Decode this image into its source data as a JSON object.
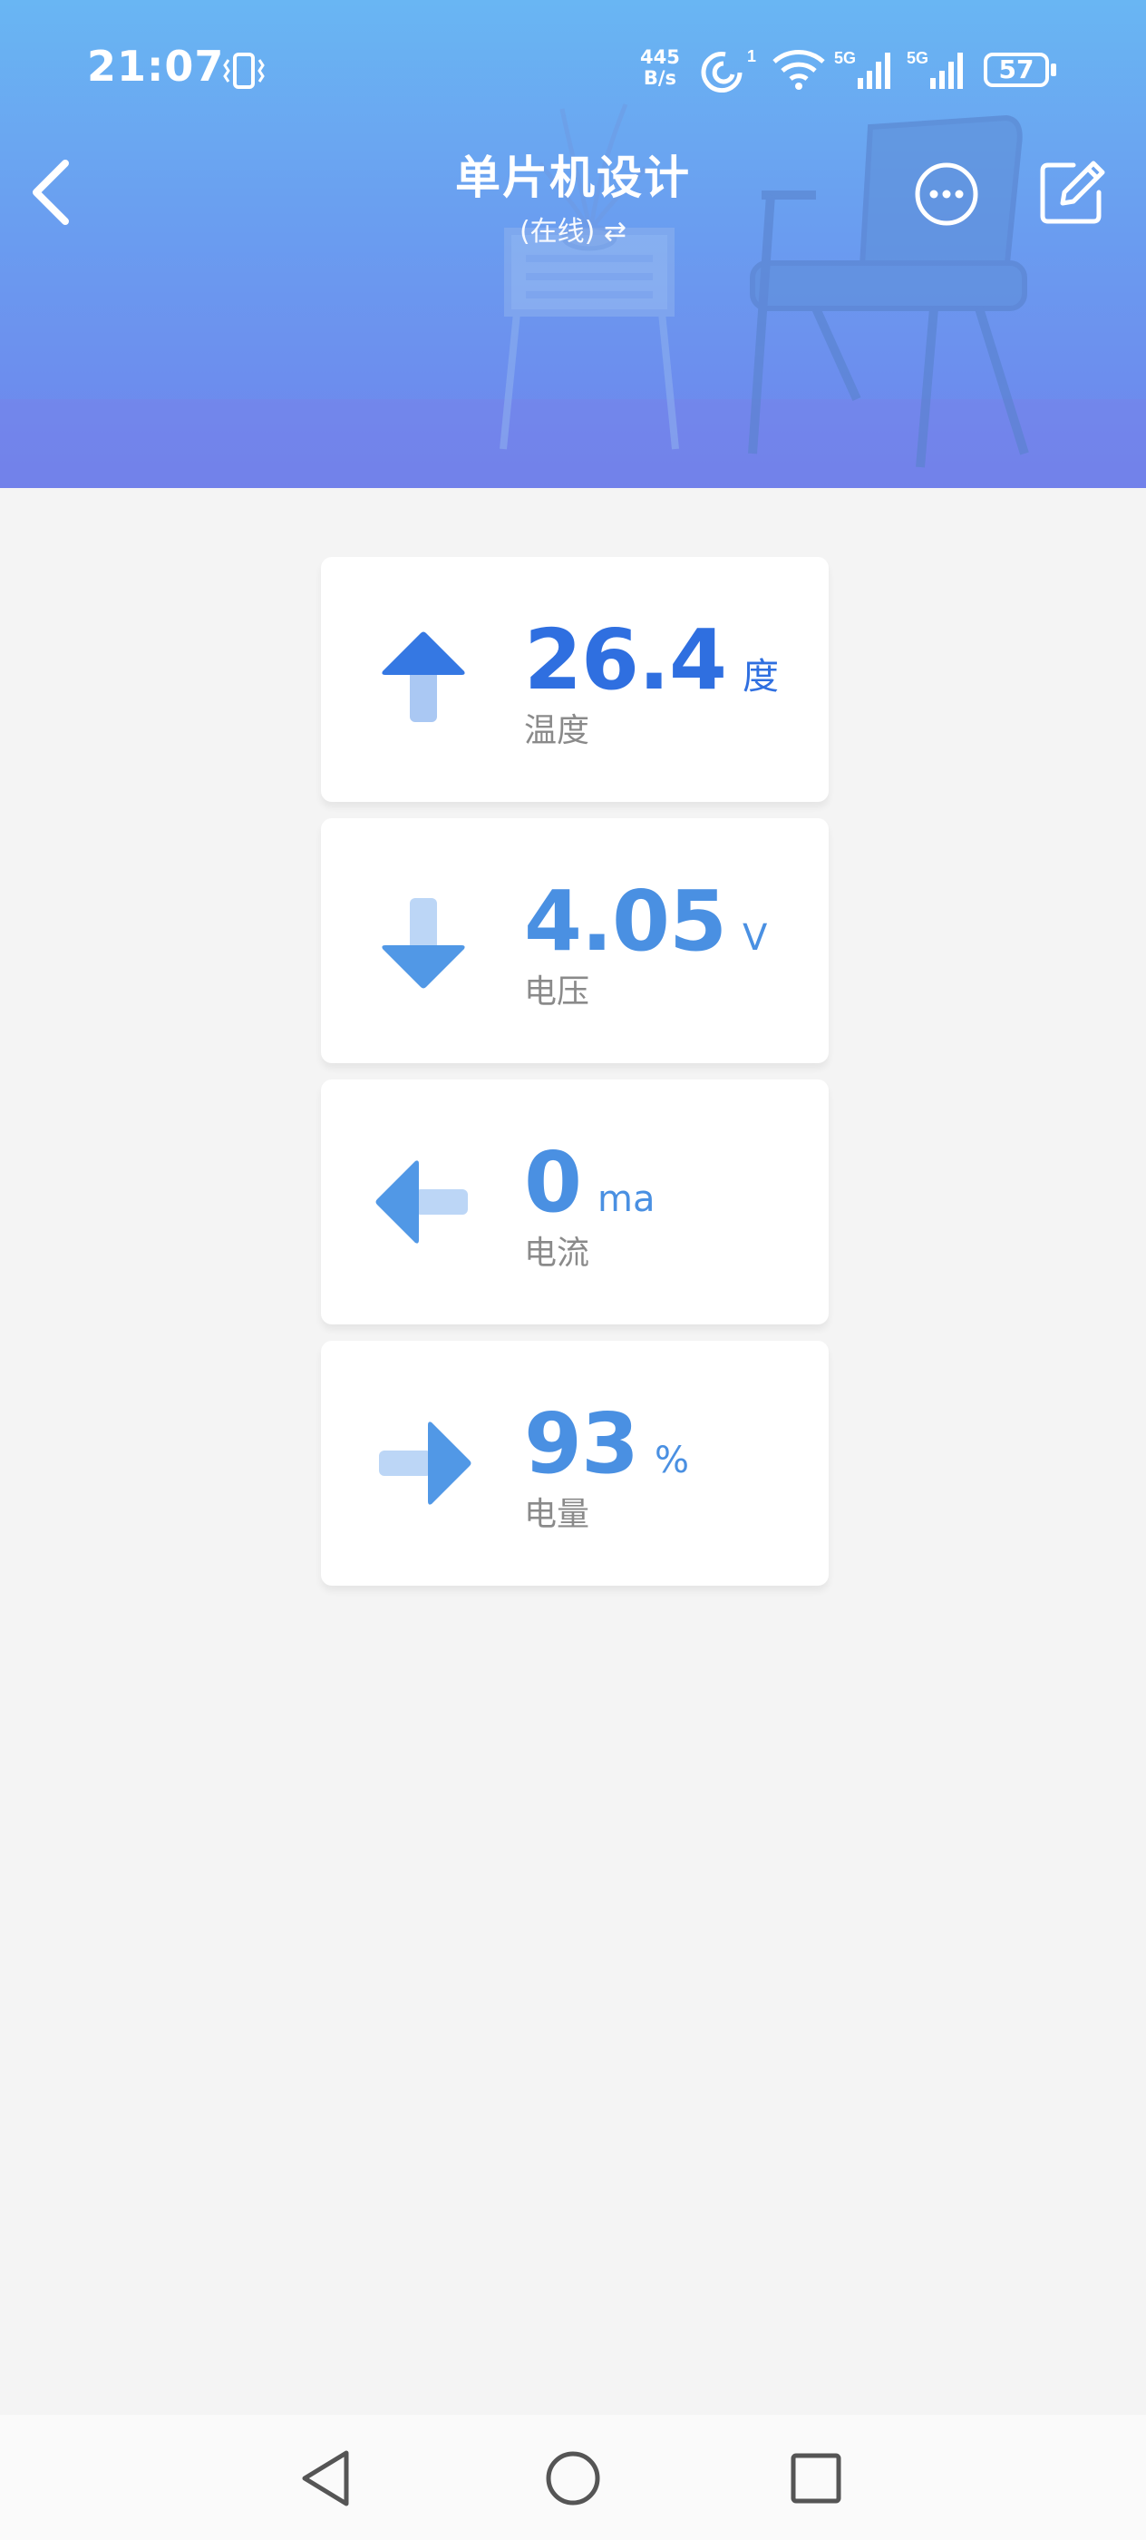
{
  "status_bar": {
    "time": "21:07",
    "net_speed_value": "445",
    "net_speed_unit": "B/s",
    "battery": "57",
    "icons": [
      "vibrate-icon",
      "hotspot-icon",
      "wifi-icon",
      "signal-5g-icon",
      "signal-5g-icon",
      "battery-icon"
    ]
  },
  "header": {
    "title": "单片机设计",
    "subtitle": "(在线) ⇄",
    "accent": "#6a9ef0"
  },
  "cards": [
    {
      "value": "26.4",
      "unit": "度",
      "label": "温度",
      "icon": "arrow-up-icon"
    },
    {
      "value": "4.05",
      "unit": "V",
      "label": "电压",
      "icon": "arrow-down-icon"
    },
    {
      "value": "0",
      "unit": "ma",
      "label": "电流",
      "icon": "arrow-left-icon"
    },
    {
      "value": "93",
      "unit": "%",
      "label": "电量",
      "icon": "arrow-right-icon"
    }
  ],
  "colors": {
    "value_blue": "#4a90e2",
    "value_blue_strong": "#2f6fe0",
    "label_gray": "#8a8a8a",
    "background": "#f4f4f4"
  }
}
